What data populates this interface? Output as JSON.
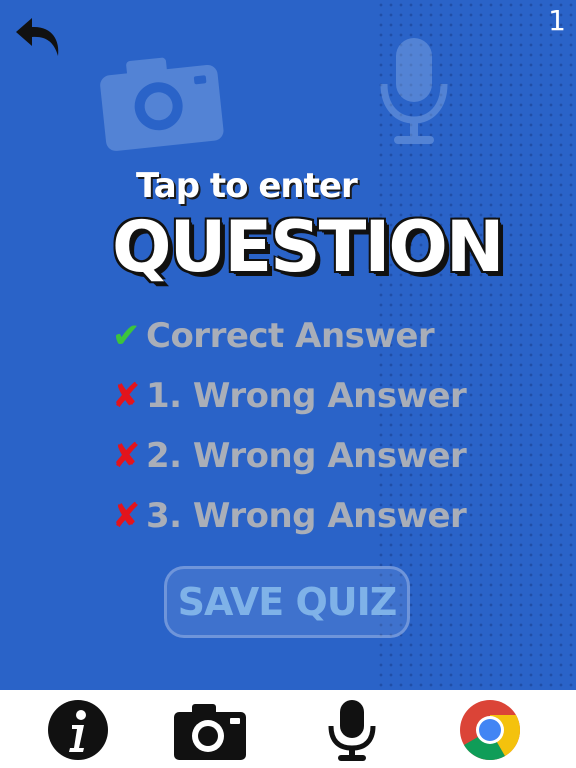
{
  "header": {
    "page_counter": "1"
  },
  "prompt": {
    "tap_text": "Tap to enter",
    "question_text": "QUESTION"
  },
  "answers": [
    {
      "mark": "✔",
      "label": "Correct Answer",
      "correct": true
    },
    {
      "mark": "✘",
      "label": "1. Wrong Answer",
      "correct": false
    },
    {
      "mark": "✘",
      "label": "2. Wrong Answer",
      "correct": false
    },
    {
      "mark": "✘",
      "label": "3. Wrong Answer",
      "correct": false
    }
  ],
  "save_button": {
    "label": "SAVE QUIZ"
  },
  "toolbar": {
    "icons": [
      "info-icon",
      "camera-icon",
      "microphone-icon",
      "chrome-icon"
    ]
  },
  "colors": {
    "background": "#2a63c8",
    "correct": "#3cc43c",
    "wrong": "#e3141c",
    "answer_text": "#a9aeb8",
    "save_text": "#7fb2e8"
  }
}
